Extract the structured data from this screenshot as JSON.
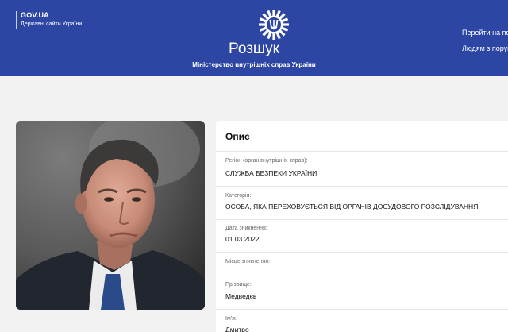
{
  "header": {
    "gov_ua": "GOV.UA",
    "gov_sites": "Державні сайти України",
    "emblem_icon": "police-star-trident-icon",
    "title": "Розшук",
    "subtitle": "Міністерство внутрішніх справ України",
    "link_portal": "Перейти на порт",
    "link_people": "Людям з порушу"
  },
  "photo": {
    "alt": "Person photo"
  },
  "description": {
    "heading": "Опис",
    "fields": [
      {
        "label": "Регіон (орган внутрішніх справ):",
        "value": "СЛУЖБА БЕЗПЕКИ УКРАЇНИ"
      },
      {
        "label": "Категорія:",
        "value": "ОСОБА, ЯКА ПЕРЕХОВУЄТЬСЯ ВІД ОРГАНІВ ДОСУДОВОГО РОЗСЛІДУВАННЯ"
      },
      {
        "label": "Дата зникнення:",
        "value": "01.03.2022"
      },
      {
        "label": "Місце зникнення:",
        "value": ""
      },
      {
        "label": "Прізвище:",
        "value": "Медведєв"
      },
      {
        "label": "Ім'я:",
        "value": "Дмитро"
      }
    ]
  },
  "colors": {
    "header_bg": "#2d46a3",
    "page_bg": "#f2f2f2",
    "card_bg": "#ffffff"
  }
}
